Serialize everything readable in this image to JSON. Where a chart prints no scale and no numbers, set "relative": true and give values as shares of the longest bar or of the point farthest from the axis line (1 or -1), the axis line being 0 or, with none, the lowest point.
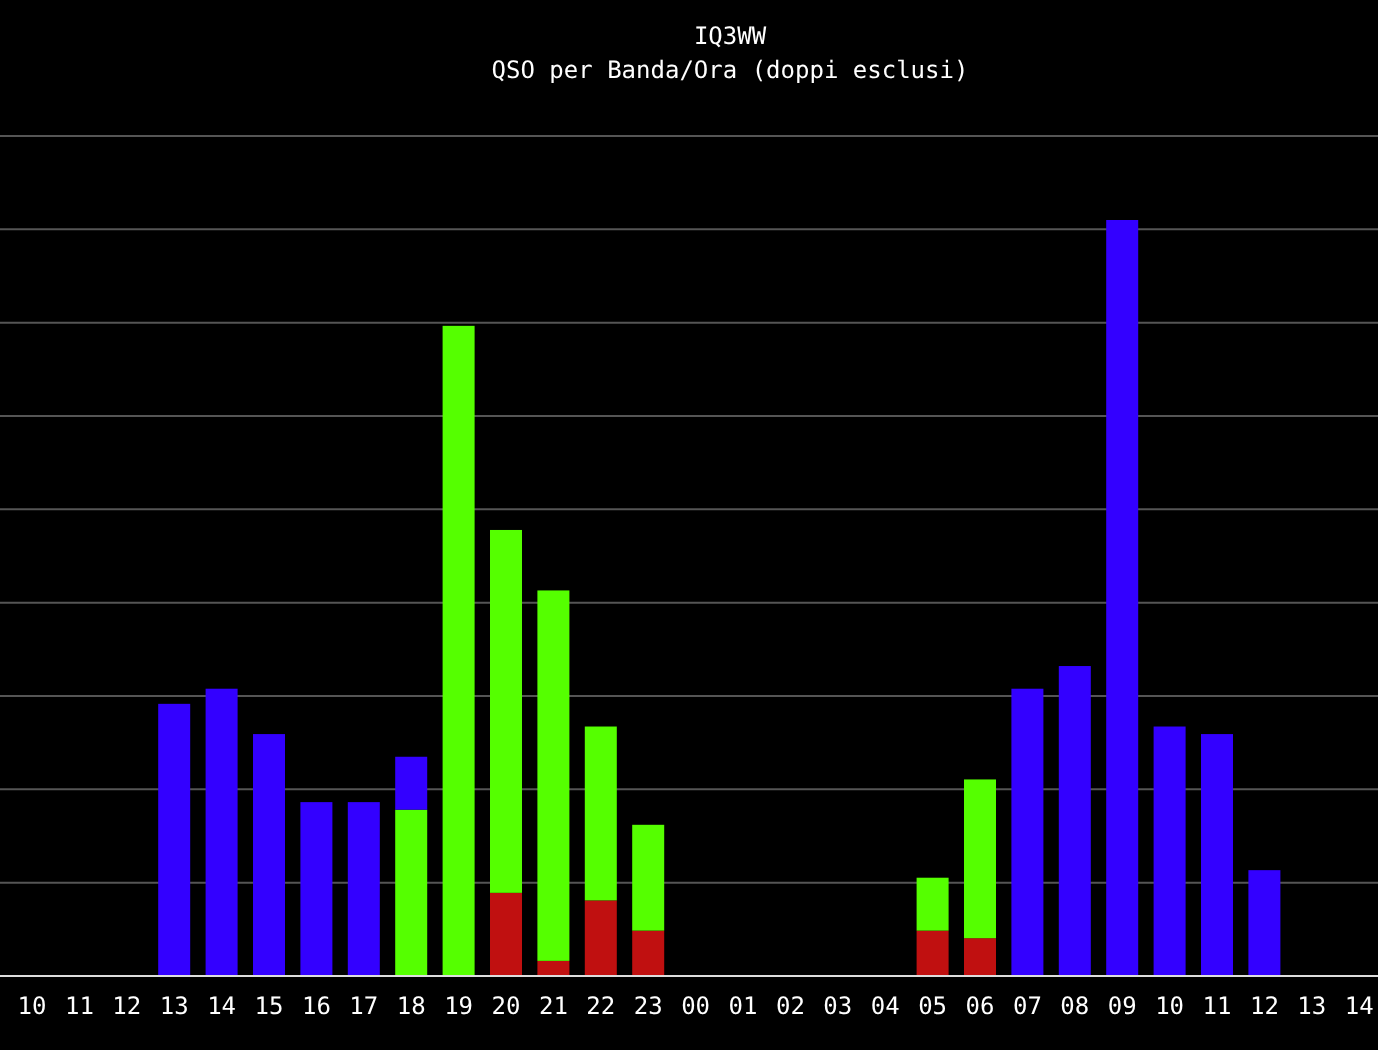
{
  "chart_data": {
    "type": "bar",
    "title": "IQ3WW",
    "subtitle": "QSO per Banda/Ora (doppi esclusi)",
    "stacked": true,
    "relative": true,
    "categories": [
      "10",
      "11",
      "12",
      "13",
      "14",
      "15",
      "16",
      "17",
      "18",
      "19",
      "20",
      "21",
      "22",
      "23",
      "00",
      "01",
      "02",
      "03",
      "04",
      "05",
      "06",
      "07",
      "08",
      "09",
      "10",
      "11",
      "12",
      "13",
      "14"
    ],
    "series": [
      {
        "color": "#c01010",
        "values": [
          0,
          0,
          0,
          0,
          0,
          0,
          0,
          0,
          0,
          0,
          0.11,
          0.02,
          0.1,
          0.06,
          0,
          0,
          0,
          0,
          0,
          0.06,
          0.05,
          0,
          0,
          0,
          0,
          0,
          0,
          0,
          0
        ]
      },
      {
        "color": "#55ff00",
        "values": [
          0,
          0,
          0,
          0,
          0,
          0,
          0,
          0,
          0.22,
          0.86,
          0.48,
          0.49,
          0.23,
          0.14,
          0,
          0,
          0,
          0,
          0,
          0.07,
          0.21,
          0,
          0,
          0,
          0,
          0,
          0,
          0,
          0
        ]
      },
      {
        "color": "#3300ff",
        "values": [
          0,
          0,
          0,
          0.36,
          0.38,
          0.32,
          0.23,
          0.23,
          0.07,
          0,
          0,
          0,
          0,
          0,
          0,
          0,
          0,
          0,
          0,
          0,
          0,
          0.38,
          0.41,
          1,
          0.33,
          0.32,
          0.14,
          0,
          0
        ]
      }
    ]
  }
}
